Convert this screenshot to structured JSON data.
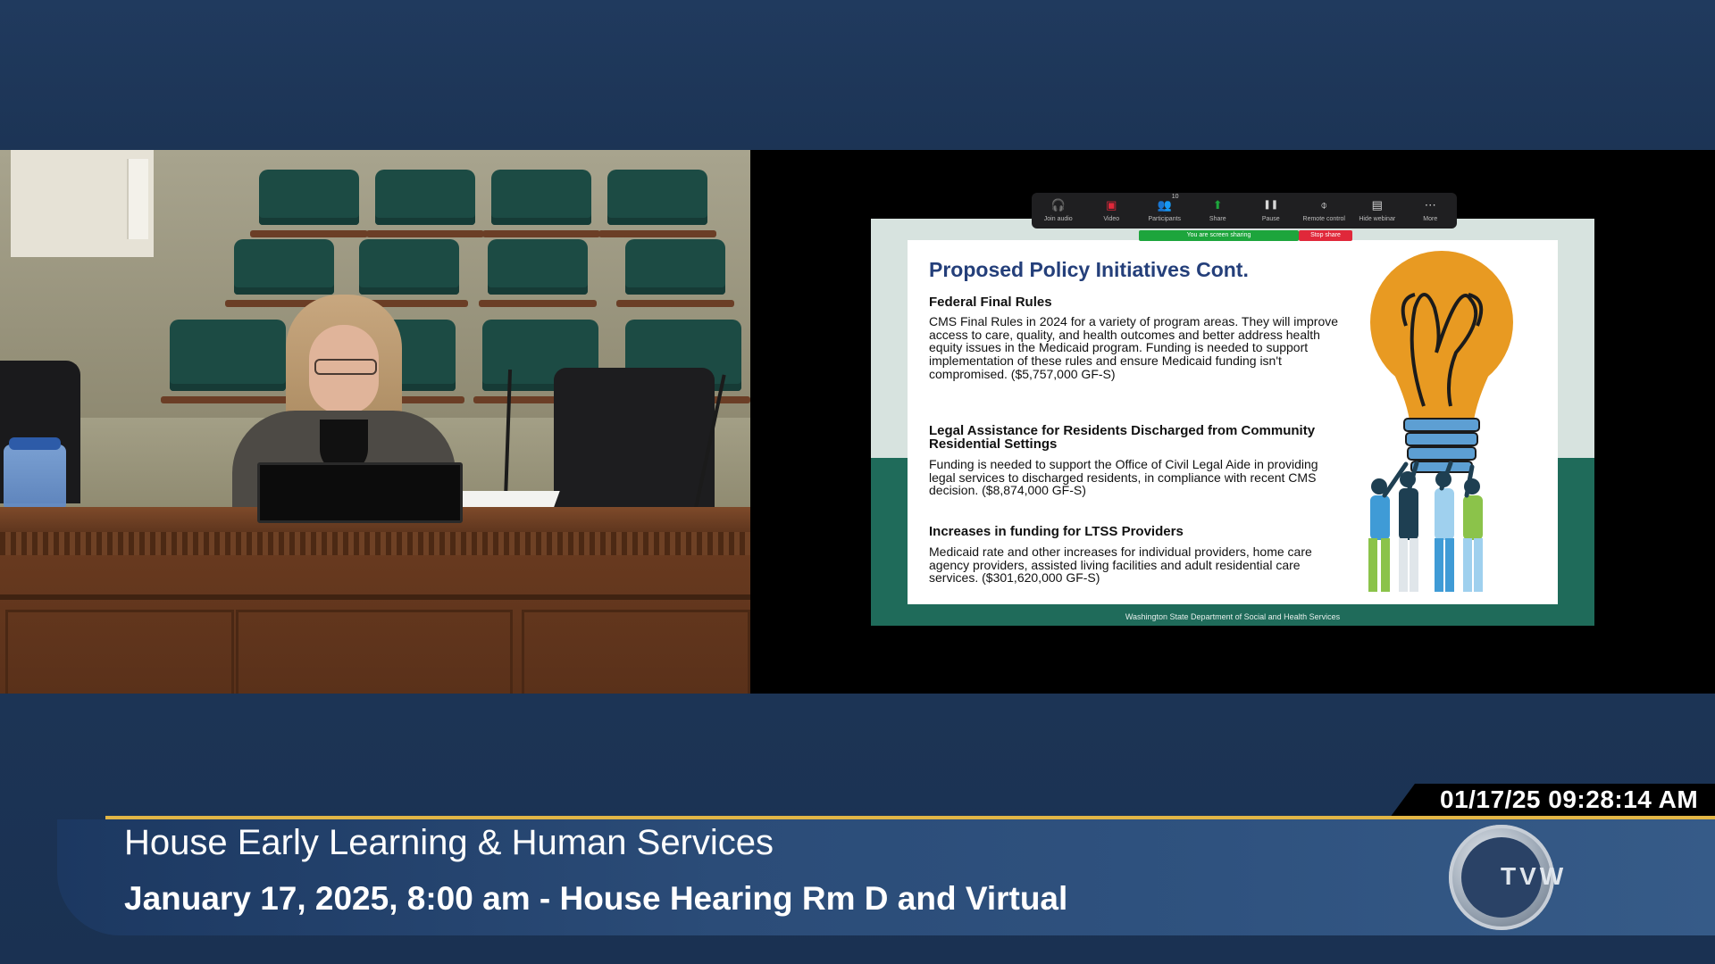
{
  "zoom_toolbar": {
    "items": [
      {
        "label": "Join audio",
        "icon": "headphones-icon",
        "glyph": "🎧"
      },
      {
        "label": "Video",
        "icon": "video-off-icon",
        "glyph": "▣"
      },
      {
        "label": "Participants",
        "icon": "participants-icon",
        "glyph": "👥"
      },
      {
        "label": "Share",
        "icon": "share-icon",
        "glyph": "⬆"
      },
      {
        "label": "Pause",
        "icon": "pause-icon",
        "glyph": "❚❚"
      },
      {
        "label": "Remote control",
        "icon": "mouse-icon",
        "glyph": "⌽"
      },
      {
        "label": "Hide webinar",
        "icon": "hide-webinar-icon",
        "glyph": "▤"
      },
      {
        "label": "More",
        "icon": "more-icon",
        "glyph": "⋯"
      }
    ],
    "participant_count": "10",
    "sharing_banner": "You are screen sharing",
    "stop_share": "Stop share",
    "sharing_color": "#1da53c",
    "stop_color": "#e0283a"
  },
  "slide": {
    "title": "Proposed Policy Initiatives Cont.",
    "sections": [
      {
        "heading": "Federal Final Rules",
        "body": "CMS Final Rules in 2024 for a variety of program areas. They will improve access to care, quality, and health outcomes and better address health equity issues in the Medicaid program. Funding is needed to support implementation of these rules and ensure Medicaid funding isn't compromised. ($5,757,000 GF-S)"
      },
      {
        "heading": "Legal Assistance for Residents Discharged from Community Residential Settings",
        "body": "Funding is needed to support the Office of Civil Legal Aide in providing legal services to discharged residents, in compliance with recent CMS decision. ($8,874,000 GF-S)"
      },
      {
        "heading": "Increases in funding for LTSS Providers",
        "body": "Medicaid rate and other increases for individual providers, home care agency providers, assisted living facilities and adult residential care services. ($301,620,000 GF-S)"
      }
    ],
    "footer": "Washington State Department of Social and Health Services",
    "title_color": "#243f7a",
    "accent_green": "#1f6b5a"
  },
  "broadcast": {
    "timestamp": "01/17/25 09:28:14 AM",
    "title": "House Early Learning & Human Services",
    "subtitle": "January 17, 2025, 8:00 am - House Hearing Rm D and Virtual",
    "logo_text": "TVW",
    "accent_gold": "#e2b646"
  }
}
